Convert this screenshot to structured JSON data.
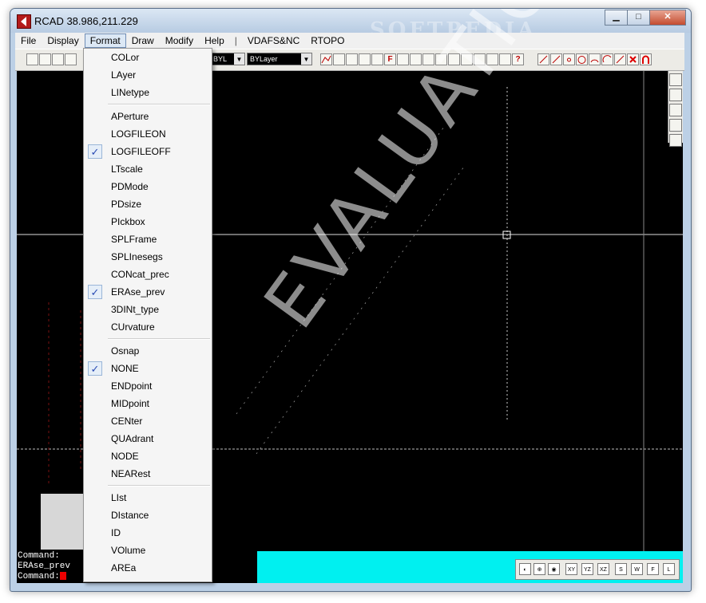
{
  "window": {
    "title": "RCAD  38.986,211.229",
    "minimize": "▁",
    "maximize": "□",
    "close": "✕"
  },
  "watermark": "SOFTPEDIA",
  "menubar": {
    "items": [
      "File",
      "Display",
      "Format",
      "Draw",
      "Modify",
      "Help",
      "|",
      "VDAFS&NC",
      "RTOPO"
    ],
    "active": "Format"
  },
  "toolbar": {
    "color_combo": "BYL",
    "linetype_combo": "BYLayer",
    "red_button_1": "F",
    "red_button_2": "?"
  },
  "format_menu": {
    "groups": [
      [
        {
          "label": "COLor",
          "checked": false
        },
        {
          "label": "LAyer",
          "checked": false
        },
        {
          "label": "LINetype",
          "checked": false
        }
      ],
      [
        {
          "label": "APerture",
          "checked": false
        },
        {
          "label": "LOGFILEON",
          "checked": false
        },
        {
          "label": "LOGFILEOFF",
          "checked": true
        },
        {
          "label": "LTscale",
          "checked": false
        },
        {
          "label": "PDMode",
          "checked": false
        },
        {
          "label": "PDsize",
          "checked": false
        },
        {
          "label": "PIckbox",
          "checked": false
        },
        {
          "label": "SPLFrame",
          "checked": false
        },
        {
          "label": "SPLInesegs",
          "checked": false
        },
        {
          "label": "CONcat_prec",
          "checked": false
        },
        {
          "label": "ERAse_prev",
          "checked": true
        },
        {
          "label": "3DINt_type",
          "checked": false
        },
        {
          "label": "CUrvature",
          "checked": false
        }
      ],
      [
        {
          "label": "Osnap",
          "checked": false
        },
        {
          "label": "NONE",
          "checked": true
        },
        {
          "label": "ENDpoint",
          "checked": false
        },
        {
          "label": "MIDpoint",
          "checked": false
        },
        {
          "label": "CENter",
          "checked": false
        },
        {
          "label": "QUAdrant",
          "checked": false
        },
        {
          "label": "NODE",
          "checked": false
        },
        {
          "label": "NEARest",
          "checked": false
        }
      ],
      [
        {
          "label": "LIst",
          "checked": false
        },
        {
          "label": "DIstance",
          "checked": false
        },
        {
          "label": "ID",
          "checked": false
        },
        {
          "label": "VOlume",
          "checked": false
        },
        {
          "label": "AREa",
          "checked": false
        }
      ]
    ],
    "check_glyph": "✓"
  },
  "command_area": {
    "lines": [
      "Command:",
      "ERAse_prev",
      "Command:"
    ]
  },
  "status_buttons": [
    "XY",
    "YZ",
    "XZ",
    "S",
    "W",
    "F",
    "L"
  ],
  "canvas_text": "EVALUATION"
}
